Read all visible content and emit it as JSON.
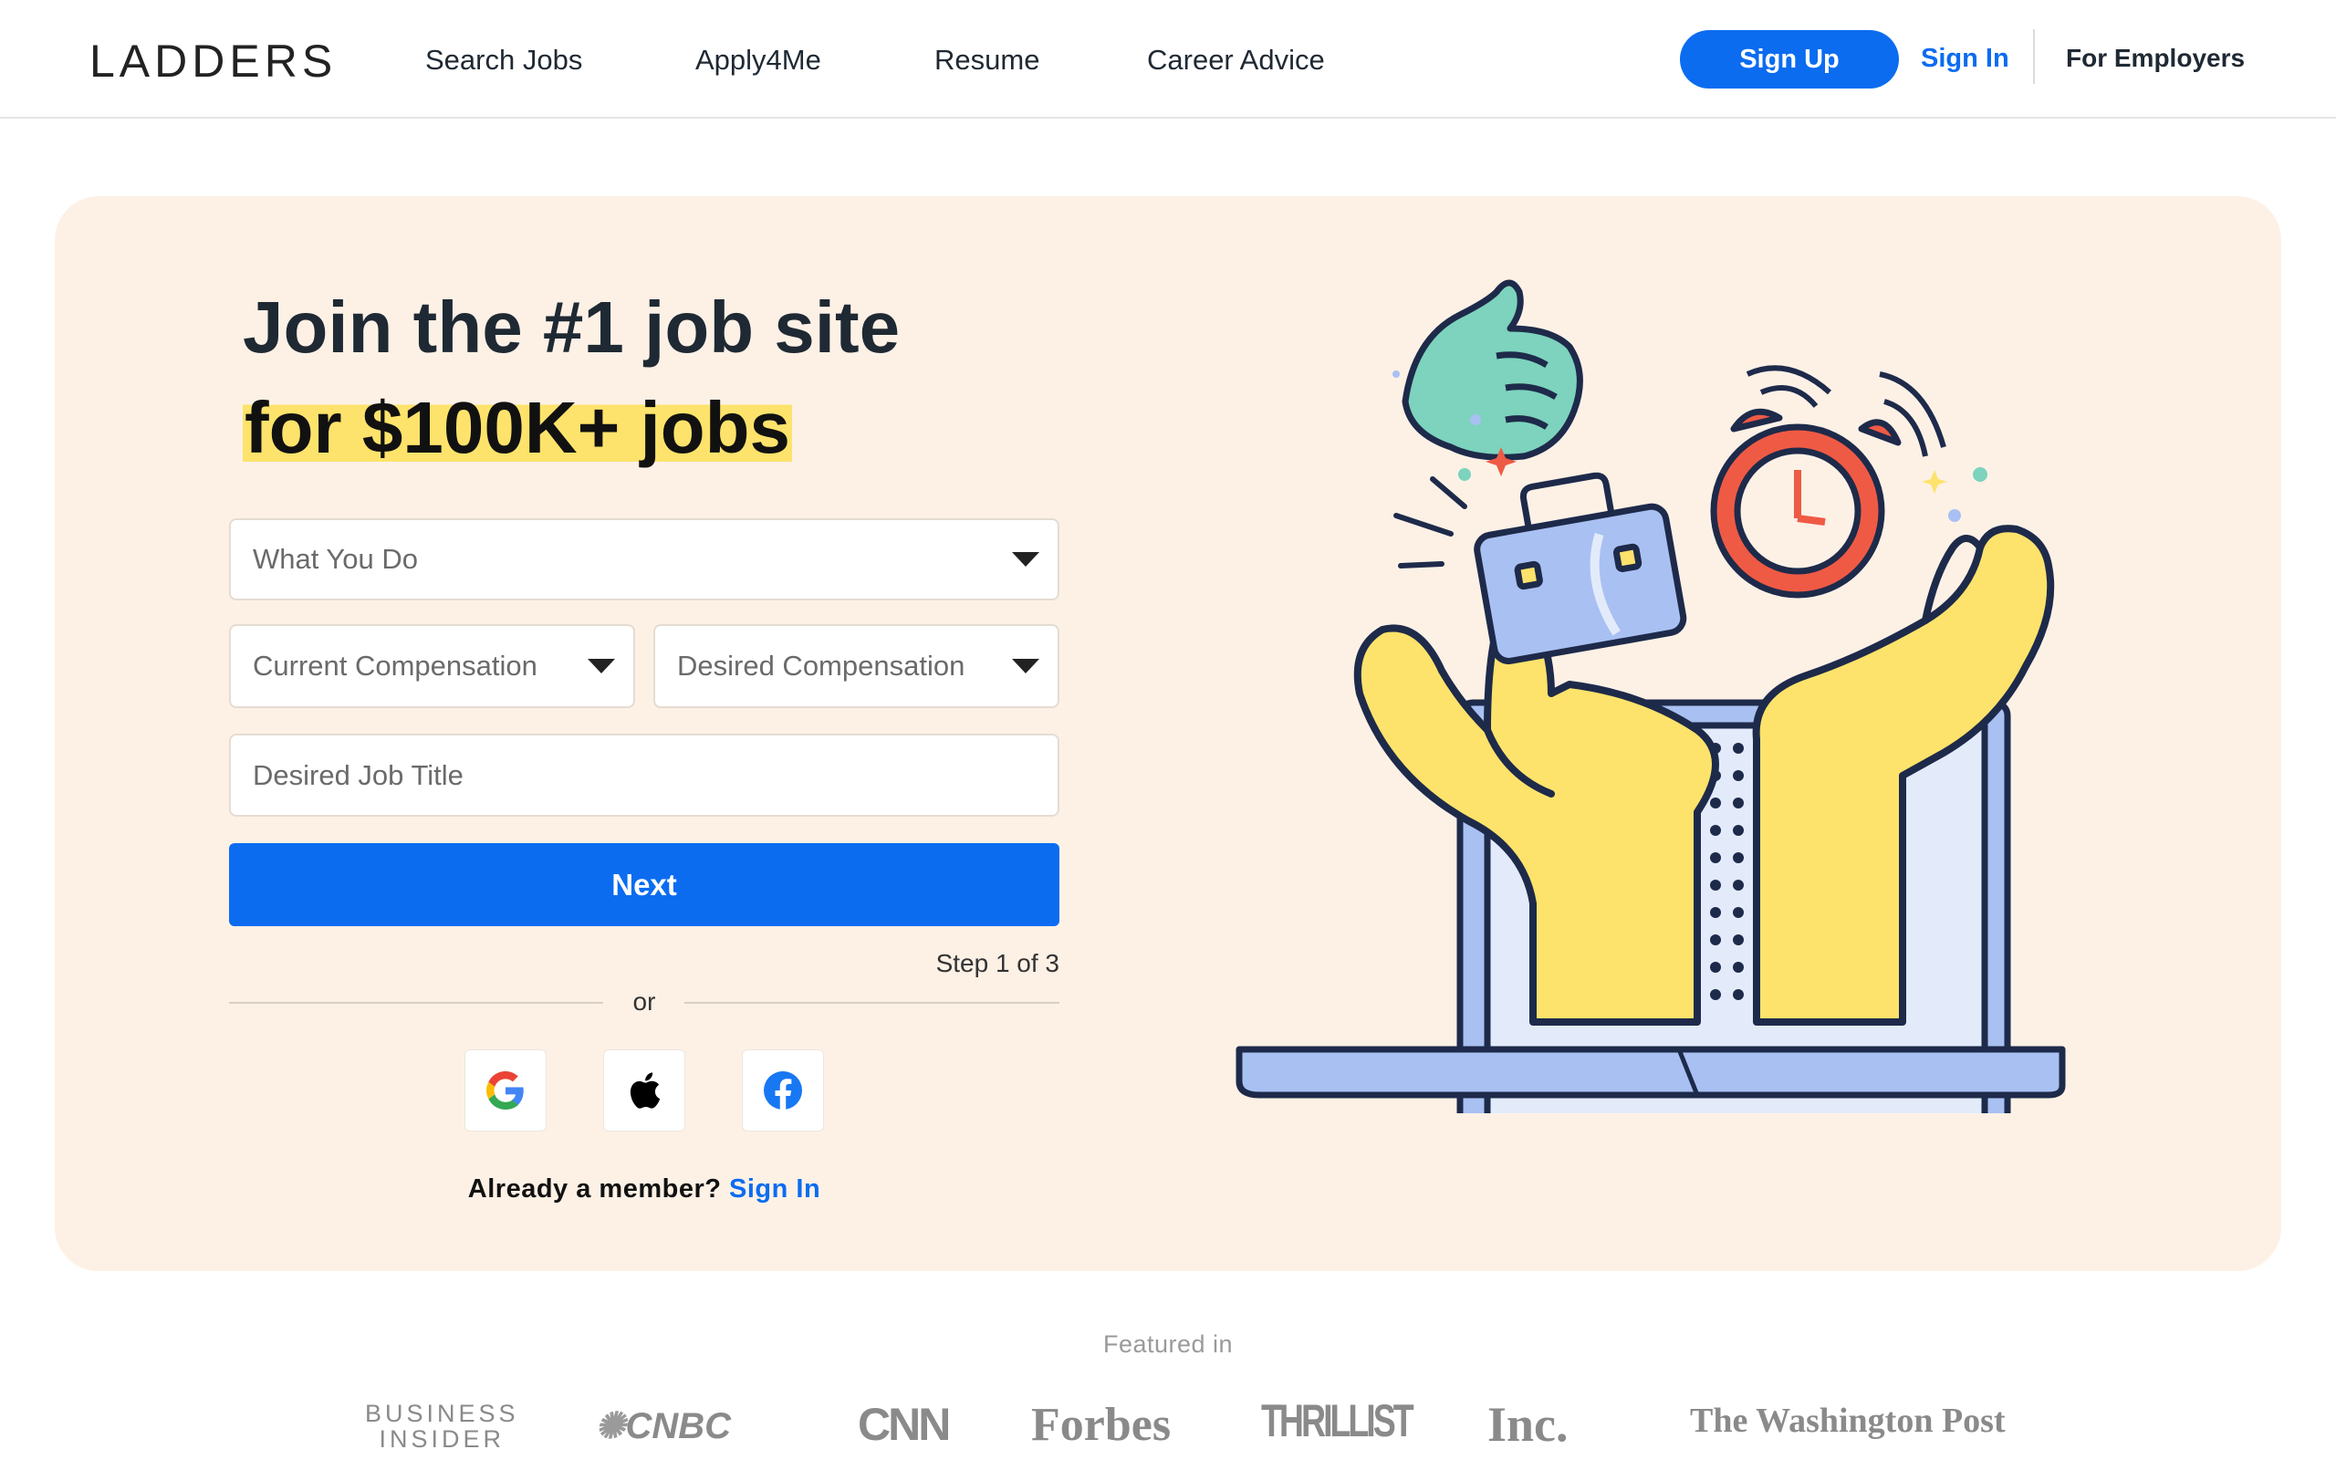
{
  "header": {
    "logo": "LADDERS",
    "nav": [
      "Search Jobs",
      "Apply4Me",
      "Resume",
      "Career Advice"
    ],
    "signup": "Sign Up",
    "signin": "Sign In",
    "employers": "For Employers"
  },
  "hero": {
    "headline_line1": "Join the #1 job site",
    "headline_line2": "for $100K+ jobs",
    "fields": {
      "what_you_do": "What You Do",
      "current_compensation": "Current Compensation",
      "desired_compensation": "Desired Compensation",
      "desired_job_title": "Desired Job Title"
    },
    "next": "Next",
    "step": "Step 1 of 3",
    "or": "or",
    "social": [
      "google-icon",
      "apple-icon",
      "facebook-icon"
    ],
    "member_prompt": "Already a member?",
    "member_signin": "Sign In"
  },
  "featured": {
    "label": "Featured in",
    "logos": [
      "BUSINESS",
      "INSIDER",
      "CNBC",
      "CNN",
      "Forbes",
      "THRILLIST",
      "Inc.",
      "The Washington Post"
    ]
  },
  "colors": {
    "accent": "#0b6cf0",
    "hero_bg": "#fdf1e6",
    "highlight": "#fde36b"
  }
}
